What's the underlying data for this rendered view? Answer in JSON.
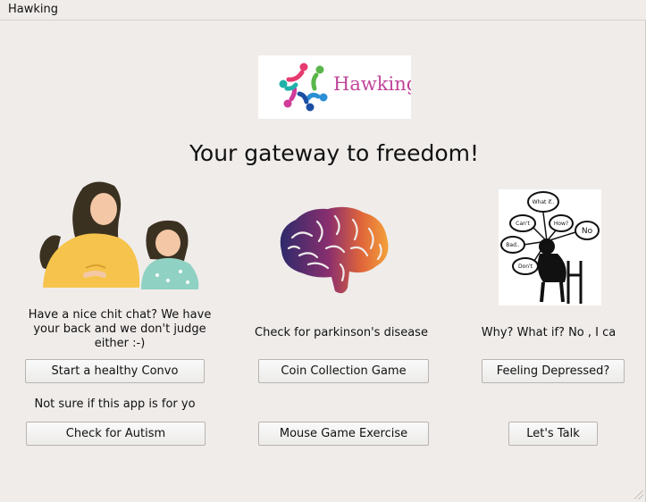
{
  "menubar": {
    "app_menu": "Hawking"
  },
  "logo": {
    "text": "Hawking"
  },
  "tagline": "Your gateway to freedom!",
  "columns": {
    "left": {
      "caption": "Have a nice chit chat? We have your back and we don't judge either :-)",
      "primary_button": "Start a healthy Convo",
      "secondary_caption": "Not sure if this app is for yo",
      "secondary_button": "Check for Autism"
    },
    "middle": {
      "caption": "Check for parkinson's disease",
      "primary_button": "Coin Collection Game",
      "secondary_button": "Mouse Game Exercise"
    },
    "right": {
      "caption": "Why? What if? No , I ca",
      "primary_button": "Feeling Depressed?",
      "secondary_button": "Let's Talk",
      "thought_bubbles": [
        "What if..",
        "Can't",
        "How?",
        "No",
        "Bad..",
        "Don't"
      ]
    }
  },
  "colors": {
    "background": "#efecea",
    "logo_brand": "#c0449a",
    "button_border": "#b7b4b0"
  }
}
